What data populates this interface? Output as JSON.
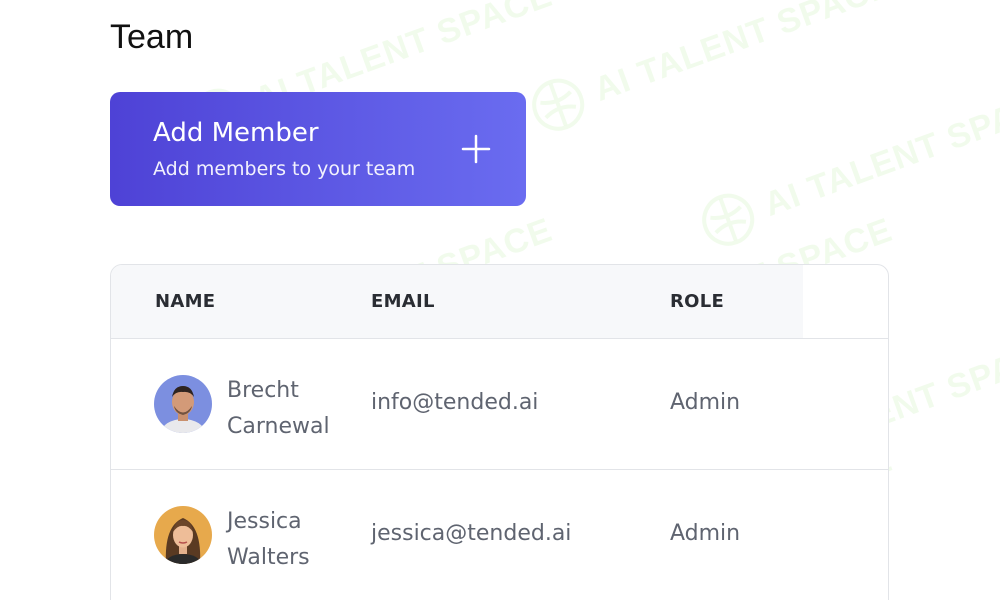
{
  "page": {
    "title": "Team"
  },
  "add_member": {
    "title": "Add Member",
    "subtitle": "Add members to your team",
    "icon": "plus-icon",
    "gradient_start": "#4e42d6",
    "gradient_end": "#6a6cf0"
  },
  "table": {
    "columns": [
      "NAME",
      "EMAIL",
      "ROLE"
    ],
    "rows": [
      {
        "first_name": "Brecht",
        "last_name": "Carnewal",
        "email": "info@tended.ai",
        "role": "Admin",
        "avatar": "avatar-man"
      },
      {
        "first_name": "Jessica",
        "last_name": "Walters",
        "email": "jessica@tended.ai",
        "role": "Admin",
        "avatar": "avatar-woman"
      }
    ]
  },
  "watermark": {
    "text": "AI TALENT SPACE",
    "color": "#78dc46"
  }
}
